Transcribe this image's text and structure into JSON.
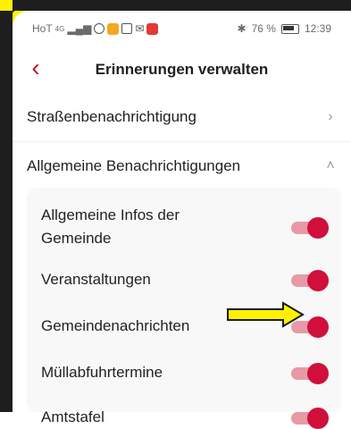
{
  "status_bar": {
    "carrier": "HoT",
    "network": "4G",
    "battery_percent": "76 %",
    "time": "12:39"
  },
  "header": {
    "back_symbol": "‹",
    "title": "Erinnerungen verwalten"
  },
  "sections": [
    {
      "label": "Straßenbenachrichtigung",
      "state": "collapsed"
    },
    {
      "label": "Allgemeine Benachrichtigungen",
      "state": "expanded"
    }
  ],
  "toggles": [
    {
      "label": "Allgemeine Infos der Gemeinde",
      "on": true
    },
    {
      "label": "Veranstaltungen",
      "on": true
    },
    {
      "label": "Gemeindenachrichten",
      "on": true
    },
    {
      "label": "Müllabfuhrtermine",
      "on": true
    },
    {
      "label": "Amtstafel",
      "on": true
    }
  ],
  "colors": {
    "accent": "#d0103a",
    "track": "#e79aa6",
    "annotation": "#fff200"
  },
  "annotation": {
    "type": "arrow",
    "points_to": "Gemeindenachrichten toggle"
  }
}
